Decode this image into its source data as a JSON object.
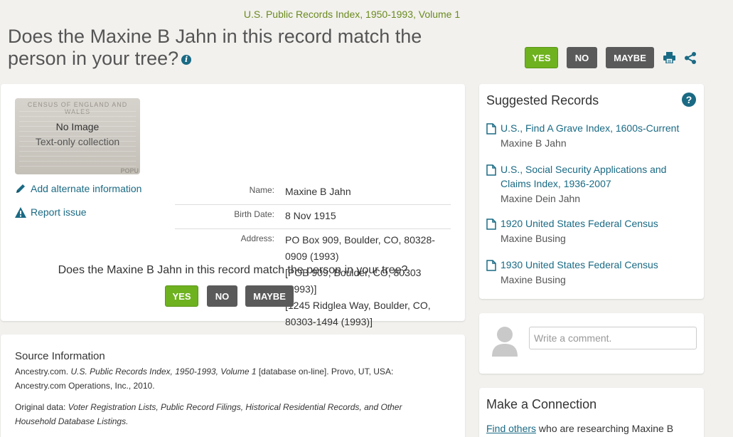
{
  "header": {
    "collection": "U.S. Public Records Index, 1950-1993, Volume 1",
    "title": "Does the Maxine B Jahn in this record match the person in your tree?",
    "info_icon": "i"
  },
  "actions": {
    "yes": "YES",
    "no": "NO",
    "maybe": "MAYBE"
  },
  "record": {
    "thumbnail": {
      "header_text": "CENSUS OF ENGLAND AND WALES",
      "no_image": "No Image",
      "text_only": "Text-only collection",
      "footer_text": "POPU"
    },
    "add_info_label": "Add alternate information",
    "report_issue_label": "Report issue",
    "facts": [
      {
        "label": "Name:",
        "values": [
          "Maxine B Jahn"
        ]
      },
      {
        "label": "Birth Date:",
        "values": [
          "8 Nov 1915"
        ]
      },
      {
        "label": "Address:",
        "values": [
          "PO Box 909, Boulder, CO, 80328-",
          "0909 (1993)",
          "[POB 909, Boulder, CO, 80303",
          "(1993)]",
          "[1245 Ridglea Way, Boulder, CO,",
          "80303-1494 (1993)]"
        ]
      }
    ],
    "question": "Does the Maxine B Jahn in this record match the person in your tree?"
  },
  "source": {
    "title": "Source Information",
    "citation_pre": "Ancestry.com. ",
    "citation_italic": "U.S. Public Records Index, 1950-1993, Volume 1",
    "citation_post": " [database on-line]. Provo, UT, USA:",
    "citation_line2": "Ancestry.com Operations, Inc., 2010.",
    "original_label": "Original data: ",
    "original_italic_1": "Voter Registration Lists, Public Record Filings, Historical Residential Records, and Other",
    "original_italic_2": "Household Database Listings."
  },
  "suggested": {
    "title": "Suggested Records",
    "help": "?",
    "items": [
      {
        "title": "U.S., Find A Grave Index, 1600s-Current",
        "name": "Maxine B Jahn"
      },
      {
        "title": "U.S., Social Security Applications and Claims Index, 1936-2007",
        "name": "Maxine Dein Jahn"
      },
      {
        "title": "1920 United States Federal Census",
        "name": "Maxine Busing"
      },
      {
        "title": "1930 United States Federal Census",
        "name": "Maxine Busing"
      }
    ]
  },
  "comment": {
    "placeholder": "Write a comment."
  },
  "connection": {
    "title": "Make a Connection",
    "link": "Find others",
    "text": " who are researching Maxine B"
  },
  "colors": {
    "accent_green": "#6eb21f",
    "link_blue": "#1a6a84",
    "title_olive": "#6b8a1e",
    "button_gray": "#5a5a5a"
  }
}
